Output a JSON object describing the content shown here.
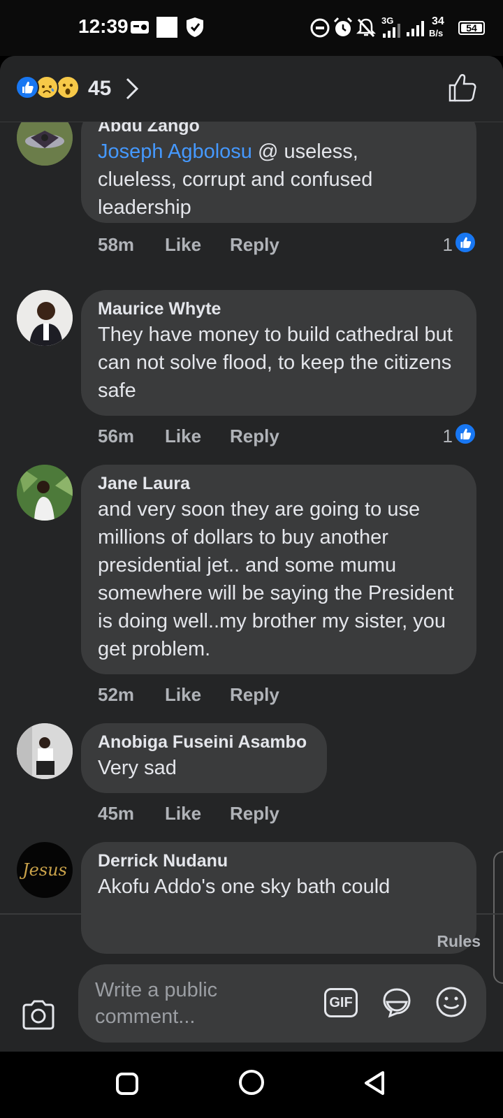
{
  "status_bar": {
    "time": "12:39",
    "network": "3G",
    "speed_value": "34",
    "speed_unit": "B/s",
    "battery": "54"
  },
  "header": {
    "reaction_count": "45",
    "reaction_icons": [
      "like-reaction",
      "sad-reaction",
      "wow-reaction"
    ]
  },
  "comments": [
    {
      "author": "Abdu Zango",
      "mention": "Joseph Agbolosu",
      "text_line1": " @ useless,",
      "text_rest": "clueless, corrupt and confused leadership",
      "time": "58m",
      "like": "Like",
      "reply": "Reply",
      "likes": "1"
    },
    {
      "author": "Maurice Whyte",
      "text": "They have money to build cathedral but can not solve flood, to keep the citizens safe",
      "time": "56m",
      "like": "Like",
      "reply": "Reply",
      "likes": "1"
    },
    {
      "author": "Jane Laura",
      "text": "and very soon they are going to use millions of dollars to buy another presidential jet.. and some mumu somewhere will be saying the President is doing well..my brother my sister, you get problem.",
      "time": "52m",
      "like": "Like",
      "reply": "Reply"
    },
    {
      "author": "Anobiga Fuseini Asambo",
      "text": "Very sad",
      "time": "45m",
      "like": "Like",
      "reply": "Reply"
    },
    {
      "author": "Derrick Nudanu",
      "text": "Akofu Addo's one sky bath could",
      "avatar_text": "Jesus"
    }
  ],
  "footer": {
    "rules": "Rules",
    "composer_placeholder": "Write a public comment...",
    "gif_label": "GIF"
  },
  "colors": {
    "panel_bg": "#242526",
    "bubble_bg": "#3a3b3c",
    "mention": "#4599ff",
    "like_blue": "#1877f2"
  }
}
